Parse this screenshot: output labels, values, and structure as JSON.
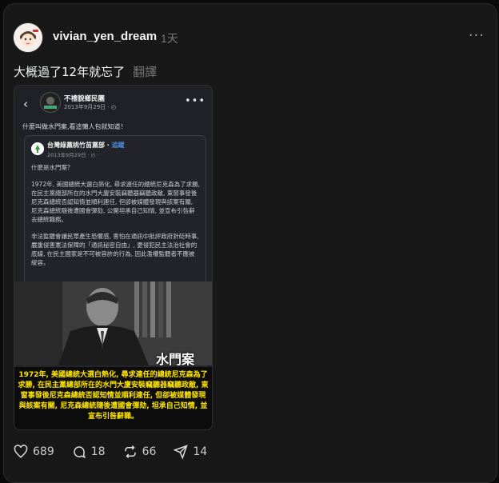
{
  "post": {
    "username": "vivian_yen_dream",
    "time": "1天",
    "text": "大概過了12年就忘了",
    "translate": "翻譯"
  },
  "embed": {
    "page_name": "不禮貌鄉民團",
    "date": "2013年9月29日 · ◴",
    "caption": "什麼叫做水門案,看這懶人包就知道！",
    "inner": {
      "name": "台灣綠黨桃竹苗黨部",
      "follow": "追蹤",
      "date": "2013年9月29日 · ◴ ·",
      "p1": "什麼是水門案？",
      "p2": "1972年, 美國總統大選白熱化, 尋求連任的總統尼克森為了求勝, 在民主黨總部所在的水門大廈安裝竊聽器竊聽政敵, 東窗事發後尼克森總統否認知情並順利連任, 但卻被媒體發現與該案有關, 尼克森總統隨後遭國會彈劾, 公開坦承自己知情, 並宣布引咎辭去總統職務。",
      "p3": "非法監聽會讓民眾產生恐懼感, 害怕在通訊中批評政府針砭時事, 嚴重侵害憲法保障的「通訊秘密自由」, 更侵犯民主法治社會的底線, 在民主國家是不可被容許的行為, 因此濫權監聽者不應被縱容。"
    },
    "photo_label": "水門案",
    "photo_caption": "1972年, 美國總統大選白熱化, 尋求連任的總統尼克森為了求勝, 在民主黨總部所在的水門大廈安裝竊聽器竊聽政敵, 東窗事發後尼克森總統否認知情並順利連任, 但卻被媒體發現與該案有關, 尼克森總統隨後遭國會彈劾, 坦承自己知情, 並宣布引咎辭職。"
  },
  "actions": {
    "likes": "689",
    "comments": "18",
    "reposts": "66",
    "shares": "14"
  },
  "icons": [
    "heart-icon",
    "comment-icon",
    "repost-icon",
    "share-icon",
    "more-icon",
    "back-icon"
  ]
}
